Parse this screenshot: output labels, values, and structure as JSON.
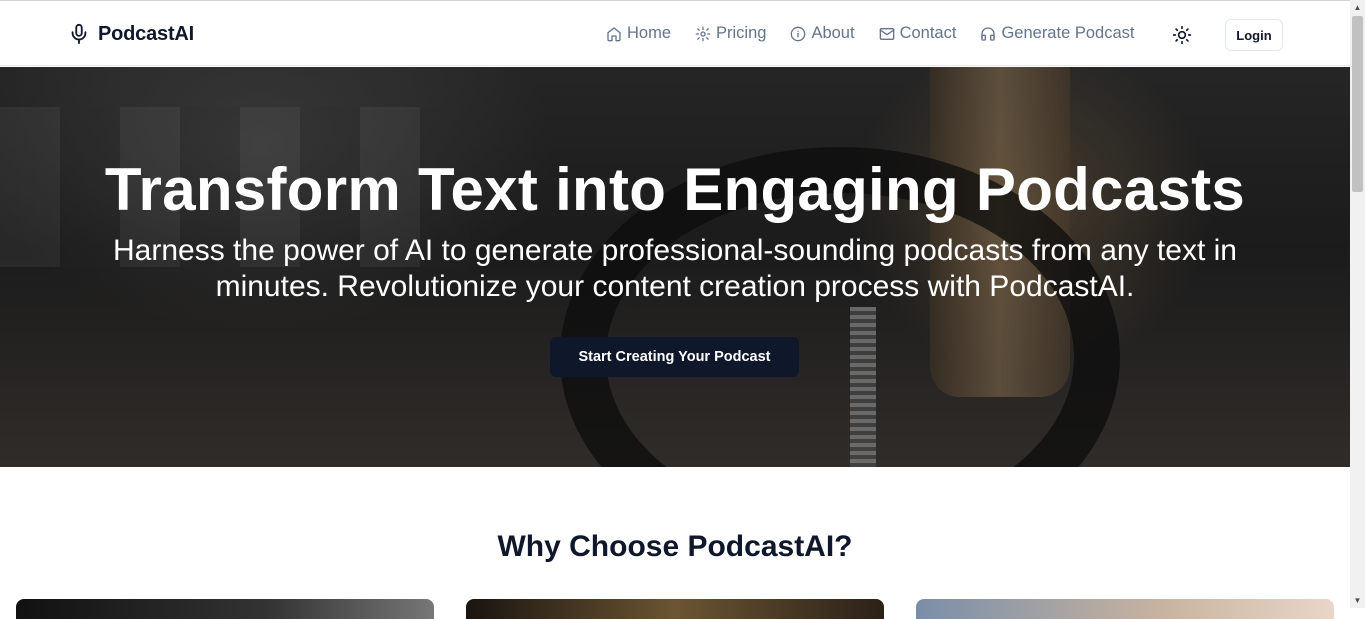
{
  "header": {
    "brand": "PodcastAI",
    "nav": [
      {
        "label": "Home",
        "icon": "home-icon"
      },
      {
        "label": "Pricing",
        "icon": "gear-icon"
      },
      {
        "label": "About",
        "icon": "info-icon"
      },
      {
        "label": "Contact",
        "icon": "mail-icon"
      },
      {
        "label": "Generate Podcast",
        "icon": "headphones-icon"
      }
    ],
    "theme_icon": "sun-icon",
    "login_label": "Login"
  },
  "hero": {
    "title": "Transform Text into Engaging Podcasts",
    "subtitle": "Harness the power of AI to generate professional-sounding podcasts from any text in minutes. Revolutionize your content creation process with PodcastAI.",
    "cta_label": "Start Creating Your Podcast"
  },
  "features": {
    "title": "Why Choose PodcastAI?"
  },
  "colors": {
    "primary": "#0f172a",
    "nav_text": "#64748b",
    "border": "#e2e8f0"
  }
}
